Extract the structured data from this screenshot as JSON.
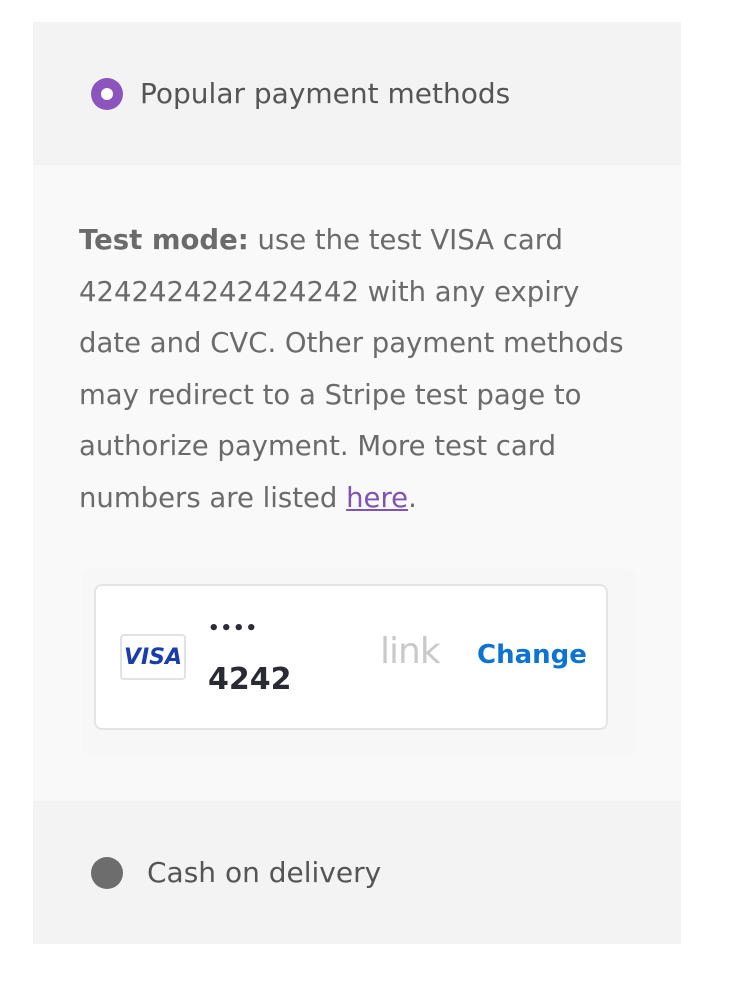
{
  "payment_methods": [
    {
      "label": "Popular payment methods",
      "selected": true
    },
    {
      "label": "Cash on delivery",
      "selected": false
    }
  ],
  "description": {
    "bold_prefix": "Test mode:",
    "text": " use the test VISA card 4242424242424242 with any expiry date and CVC. Other payment methods may redirect to a Stripe test page to authorize payment. More test card numbers are listed ",
    "link_text": "here",
    "suffix": "."
  },
  "saved_card": {
    "brand": "VISA",
    "dots": "••••",
    "last4": "4242",
    "provider_logo": "link",
    "change_label": "Change"
  },
  "colors": {
    "accent": "#8c55be",
    "link": "#7f54b3",
    "change": "#0d73d1"
  }
}
